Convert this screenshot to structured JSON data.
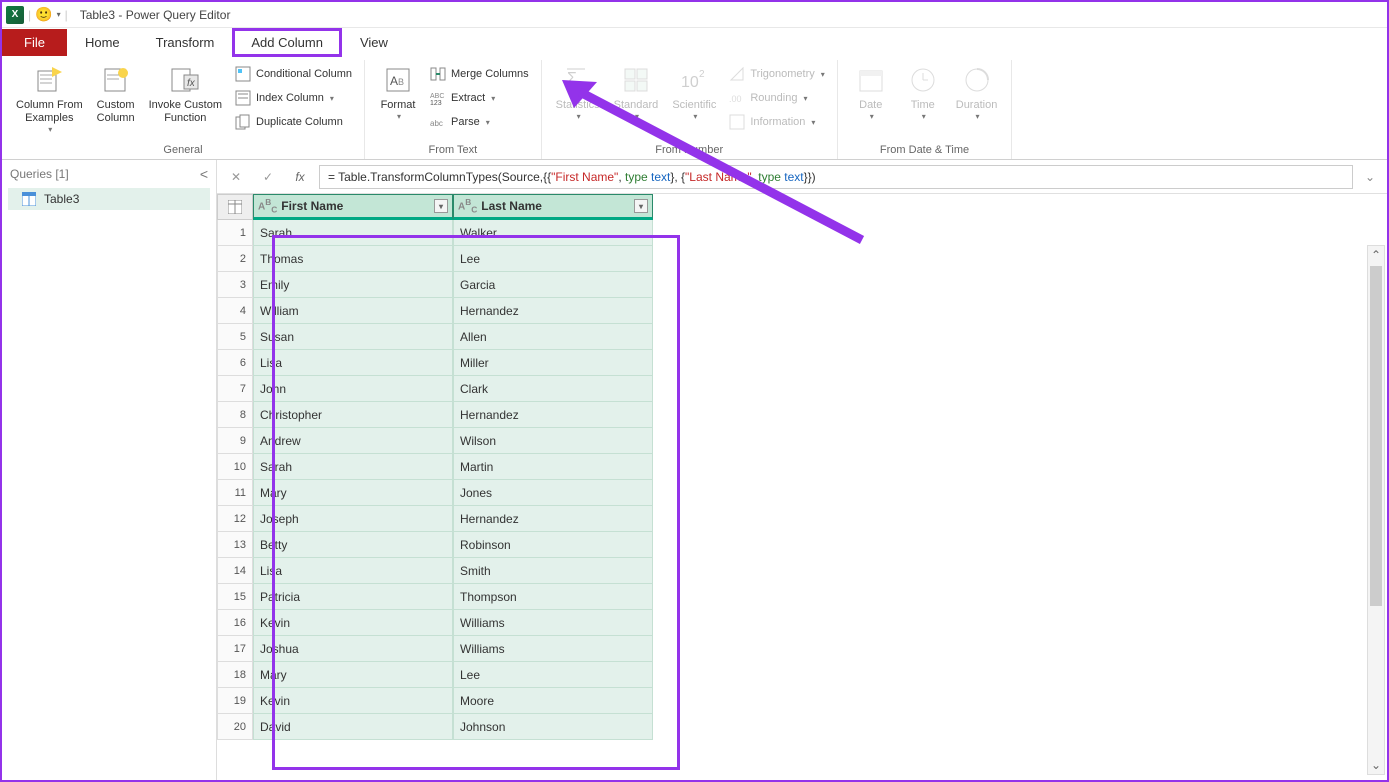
{
  "title": "Table3 - Power Query Editor",
  "tabs": {
    "file": "File",
    "home": "Home",
    "transform": "Transform",
    "addcolumn": "Add Column",
    "view": "View"
  },
  "ribbon": {
    "general": {
      "label": "General",
      "colFromExamples": "Column From\nExamples",
      "customColumn": "Custom\nColumn",
      "invokeCustomFn": "Invoke Custom\nFunction",
      "conditional": "Conditional Column",
      "index": "Index Column",
      "duplicate": "Duplicate Column"
    },
    "fromText": {
      "label": "From Text",
      "format": "Format",
      "merge": "Merge Columns",
      "extract": "Extract",
      "parse": "Parse"
    },
    "fromNumber": {
      "label": "From Number",
      "statistics": "Statistics",
      "standard": "Standard",
      "scientific": "Scientific",
      "trig": "Trigonometry",
      "rounding": "Rounding",
      "info": "Information"
    },
    "fromDateTime": {
      "label": "From Date & Time",
      "date": "Date",
      "time": "Time",
      "duration": "Duration"
    }
  },
  "sidebar": {
    "heading": "Queries [1]",
    "items": [
      "Table3"
    ]
  },
  "formula": {
    "prefix": "= Table.TransformColumnTypes(Source,{{",
    "str1": "\"First Name\"",
    "mid1": ", ",
    "kw1": "type",
    "sp1": " ",
    "typ1": "text",
    "mid2": "}, {",
    "str2": "\"Last Name\"",
    "mid3": ", ",
    "kw2": "type",
    "sp2": " ",
    "typ2": "text",
    "suffix": "}})"
  },
  "table": {
    "columns": [
      "First Name",
      "Last Name"
    ],
    "rows": [
      [
        "Sarah",
        "Walker"
      ],
      [
        "Thomas",
        "Lee"
      ],
      [
        "Emily",
        "Garcia"
      ],
      [
        "William",
        "Hernandez"
      ],
      [
        "Susan",
        "Allen"
      ],
      [
        "Lisa",
        "Miller"
      ],
      [
        "John",
        "Clark"
      ],
      [
        "Christopher",
        "Hernandez"
      ],
      [
        "Andrew",
        "Wilson"
      ],
      [
        "Sarah",
        "Martin"
      ],
      [
        "Mary",
        "Jones"
      ],
      [
        "Joseph",
        "Hernandez"
      ],
      [
        "Betty",
        "Robinson"
      ],
      [
        "Lisa",
        "Smith"
      ],
      [
        "Patricia",
        "Thompson"
      ],
      [
        "Kevin",
        "Williams"
      ],
      [
        "Joshua",
        "Williams"
      ],
      [
        "Mary",
        "Lee"
      ],
      [
        "Kevin",
        "Moore"
      ],
      [
        "David",
        "Johnson"
      ]
    ]
  }
}
